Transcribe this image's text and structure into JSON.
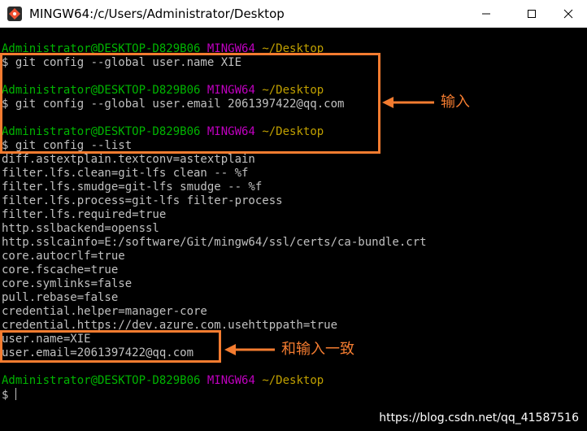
{
  "window": {
    "title": "MINGW64:/c/Users/Administrator/Desktop"
  },
  "terminal": {
    "prompts": [
      {
        "user": "Administrator@DESKTOP-D829B06",
        "env": "MINGW64",
        "path": "~/Desktop",
        "command": "$ git config --global user.name XIE"
      },
      {
        "user": "Administrator@DESKTOP-D829B06",
        "env": "MINGW64",
        "path": "~/Desktop",
        "command": "$ git config --global user.email 2061397422@qq.com"
      },
      {
        "user": "Administrator@DESKTOP-D829B06",
        "env": "MINGW64",
        "path": "~/Desktop",
        "command": "$ git config --list"
      },
      {
        "user": "Administrator@DESKTOP-D829B06",
        "env": "MINGW64",
        "path": "~/Desktop",
        "command": "$ "
      }
    ],
    "output": [
      "diff.astextplain.textconv=astextplain",
      "filter.lfs.clean=git-lfs clean -- %f",
      "filter.lfs.smudge=git-lfs smudge -- %f",
      "filter.lfs.process=git-lfs filter-process",
      "filter.lfs.required=true",
      "http.sslbackend=openssl",
      "http.sslcainfo=E:/software/Git/mingw64/ssl/certs/ca-bundle.crt",
      "core.autocrlf=true",
      "core.fscache=true",
      "core.symlinks=false",
      "pull.rebase=false",
      "credential.helper=manager-core",
      "credential.https://dev.azure.com.usehttppath=true",
      "user.name=XIE",
      "user.email=2061397422@qq.com"
    ]
  },
  "annotations": {
    "input_label": "输入",
    "match_label": "和输入一致"
  },
  "watermark": "https://blog.csdn.net/qq_41587516",
  "colors": {
    "user": "#00b400",
    "env": "#c000c0",
    "path": "#c0a000",
    "annotation": "#f47c30"
  }
}
